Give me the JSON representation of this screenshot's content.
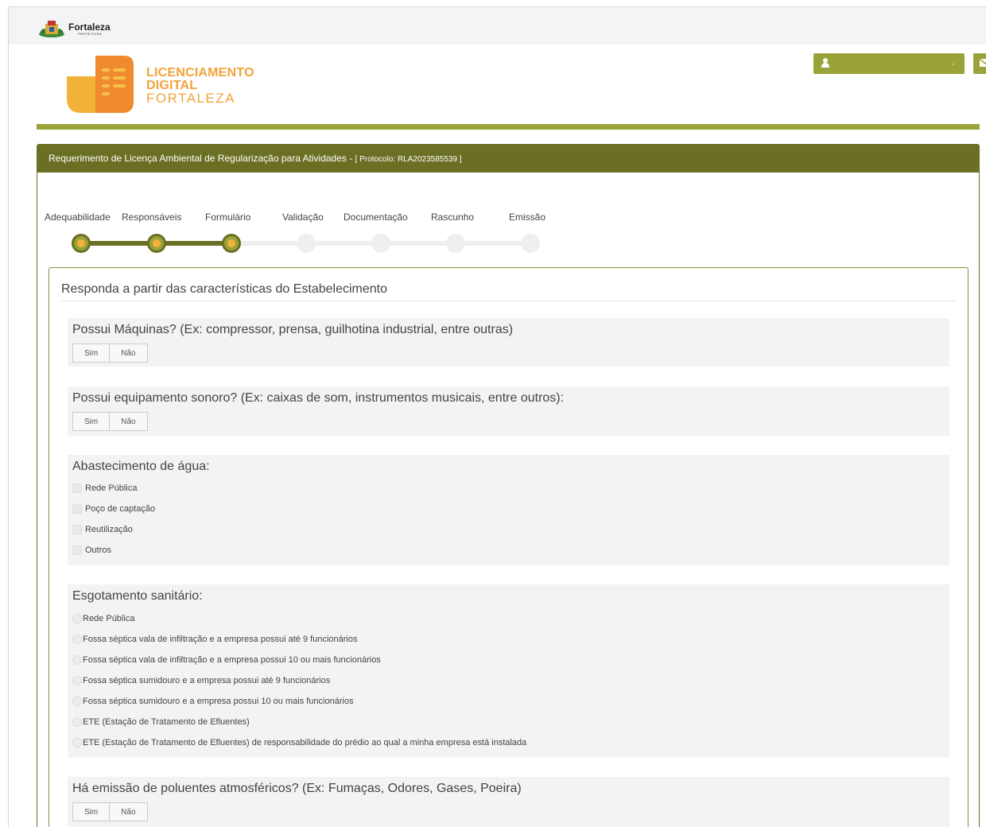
{
  "header": {
    "city_name": "Fortaleza",
    "city_sub": "PREFEITURA",
    "brand_line1": "LICENCIAMENTO",
    "brand_line2": "DIGITAL",
    "brand_line3": "FORTALEZA",
    "user_icon": "user-icon",
    "mail_icon": "envelope-icon",
    "accent_color": "#9aa33a",
    "dark_color": "#6b6f23",
    "brand_orange": "#f2a33a"
  },
  "panel": {
    "title_main": "Requerimento de Licença Ambiental de Regularização para Atividades - ",
    "title_protocol": "[ Protocolo: RLA2023585539 ]"
  },
  "steps": [
    {
      "label": "Adequabilidade",
      "state": "done"
    },
    {
      "label": "Responsáveis",
      "state": "done"
    },
    {
      "label": "Formulário",
      "state": "done"
    },
    {
      "label": "Validação",
      "state": "todo"
    },
    {
      "label": "Documentação",
      "state": "todo"
    },
    {
      "label": "Rascunho",
      "state": "todo"
    },
    {
      "label": "Emissão",
      "state": "todo"
    }
  ],
  "form": {
    "title": "Responda a partir das características do Estabelecimento",
    "yes_label": "Sim",
    "no_label": "Não",
    "q_machines": "Possui Máquinas? (Ex: compressor, prensa, guilhotina industrial, entre outras)",
    "q_sound": "Possui equipamento sonoro? (Ex: caixas de som, instrumentos musicais, entre outros):",
    "q_water": "Abastecimento de água:",
    "water_options": [
      "Rede Pública",
      "Poço de captação",
      "Reutilização",
      "Outros"
    ],
    "q_sewage": "Esgotamento sanitário:",
    "sewage_options": [
      "Rede Pública",
      "Fossa séptica vala de infiltração e a empresa possui até 9 funcionários",
      "Fossa séptica vala de infiltração e a empresa possui 10 ou mais funcionários",
      "Fossa séptica sumidouro e a empresa possui até 9 funcionários",
      "Fossa séptica sumidouro e a empresa possui 10 ou mais funcionários",
      "ETE (Estação de Tratamento de Efluentes)",
      "ETE (Estação de Tratamento de Efluentes) de responsabilidade do prédio ao qual a minha empresa está instalada"
    ],
    "q_emission": "Há emissão de poluentes atmosféricos? (Ex: Fumaças, Odores, Gases, Poeira)"
  }
}
